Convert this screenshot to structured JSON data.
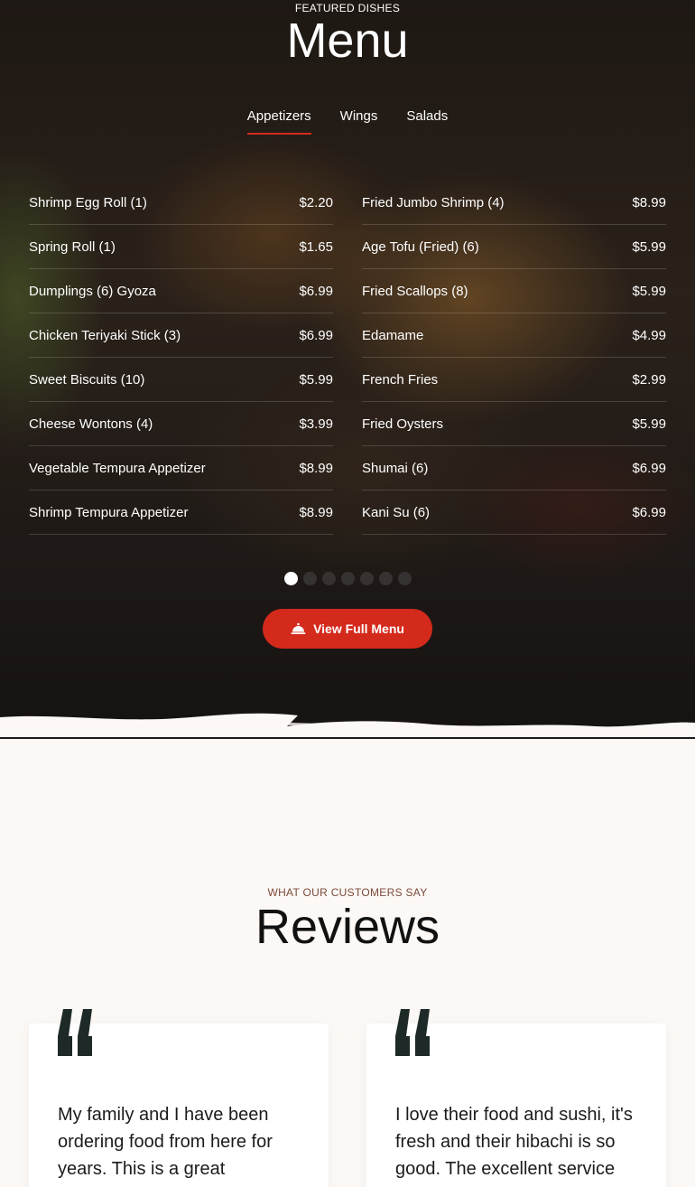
{
  "menu": {
    "eyebrow": "FEATURED DISHES",
    "title": "Menu",
    "tabs": [
      {
        "label": "Appetizers",
        "active": true
      },
      {
        "label": "Wings",
        "active": false
      },
      {
        "label": "Salads",
        "active": false
      }
    ],
    "left_items": [
      {
        "name": "Shrimp Egg Roll (1)",
        "price": "$2.20"
      },
      {
        "name": "Spring Roll (1)",
        "price": "$1.65"
      },
      {
        "name": "Dumplings (6) Gyoza",
        "price": "$6.99"
      },
      {
        "name": "Chicken Teriyaki Stick (3)",
        "price": "$6.99"
      },
      {
        "name": "Sweet Biscuits (10)",
        "price": "$5.99"
      },
      {
        "name": "Cheese Wontons (4)",
        "price": "$3.99"
      },
      {
        "name": "Vegetable Tempura Appetizer",
        "price": "$8.99"
      },
      {
        "name": "Shrimp Tempura Appetizer",
        "price": "$8.99"
      }
    ],
    "right_items": [
      {
        "name": "Fried Jumbo Shrimp (4)",
        "price": "$8.99"
      },
      {
        "name": "Age Tofu (Fried) (6)",
        "price": "$5.99"
      },
      {
        "name": "Fried Scallops (8)",
        "price": "$5.99"
      },
      {
        "name": "Edamame",
        "price": "$4.99"
      },
      {
        "name": "French Fries",
        "price": "$2.99"
      },
      {
        "name": "Fried Oysters",
        "price": "$5.99"
      },
      {
        "name": "Shumai (6)",
        "price": "$6.99"
      },
      {
        "name": "Kani Su (6)",
        "price": "$6.99"
      }
    ],
    "pagination": {
      "total": 7,
      "active_index": 0
    },
    "cta_label": "View Full Menu",
    "cta_icon": "cloche-icon",
    "accent_color": "#d42a1c"
  },
  "reviews": {
    "eyebrow": "WHAT OUR CUSTOMERS SAY",
    "title": "Reviews",
    "quote_icon": "quote-icon",
    "quote_color": "#1e2a28",
    "items": [
      {
        "text": "My family and I have been ordering food from here for years. This is a great"
      },
      {
        "text": "I love their food and sushi, it's fresh and their hibachi is so good. The excellent service"
      }
    ]
  }
}
